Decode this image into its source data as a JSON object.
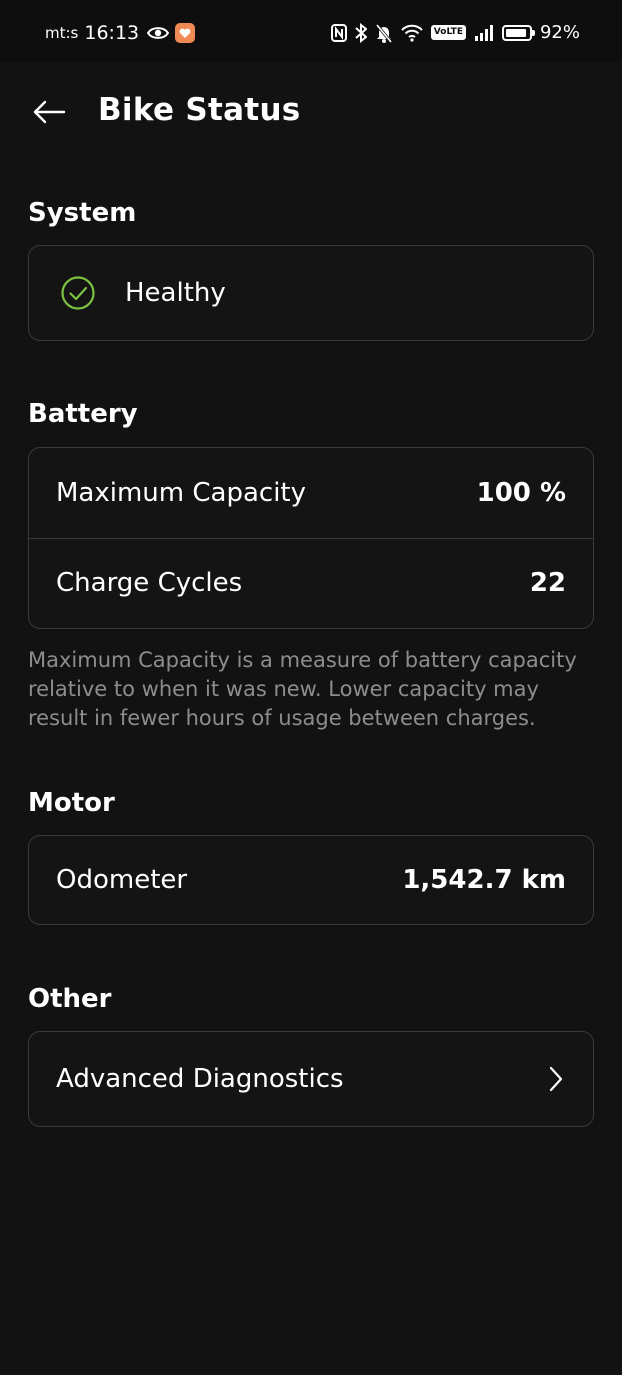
{
  "status_bar": {
    "carrier": "mt:s",
    "time": "16:13",
    "volte": "VoLTE",
    "battery_level": 0.92,
    "battery_text": "92%"
  },
  "header": {
    "title": "Bike Status",
    "back_icon": "arrow-left-icon"
  },
  "system": {
    "title": "System",
    "status": "Healthy",
    "status_icon": "check-circle-icon",
    "status_color": "#7cc142"
  },
  "battery": {
    "title": "Battery",
    "rows": [
      {
        "label": "Maximum Capacity",
        "value": "100 %"
      },
      {
        "label": "Charge Cycles",
        "value": "22"
      }
    ],
    "note": "Maximum Capacity is a measure of battery capacity relative to when it was new. Lower capacity may result in fewer hours of usage between charges."
  },
  "motor": {
    "title": "Motor",
    "rows": [
      {
        "label": "Odometer",
        "value": "1,542.7 km"
      }
    ]
  },
  "other": {
    "title": "Other",
    "rows": [
      {
        "label": "Advanced Diagnostics",
        "icon": "chevron-right-icon"
      }
    ]
  }
}
